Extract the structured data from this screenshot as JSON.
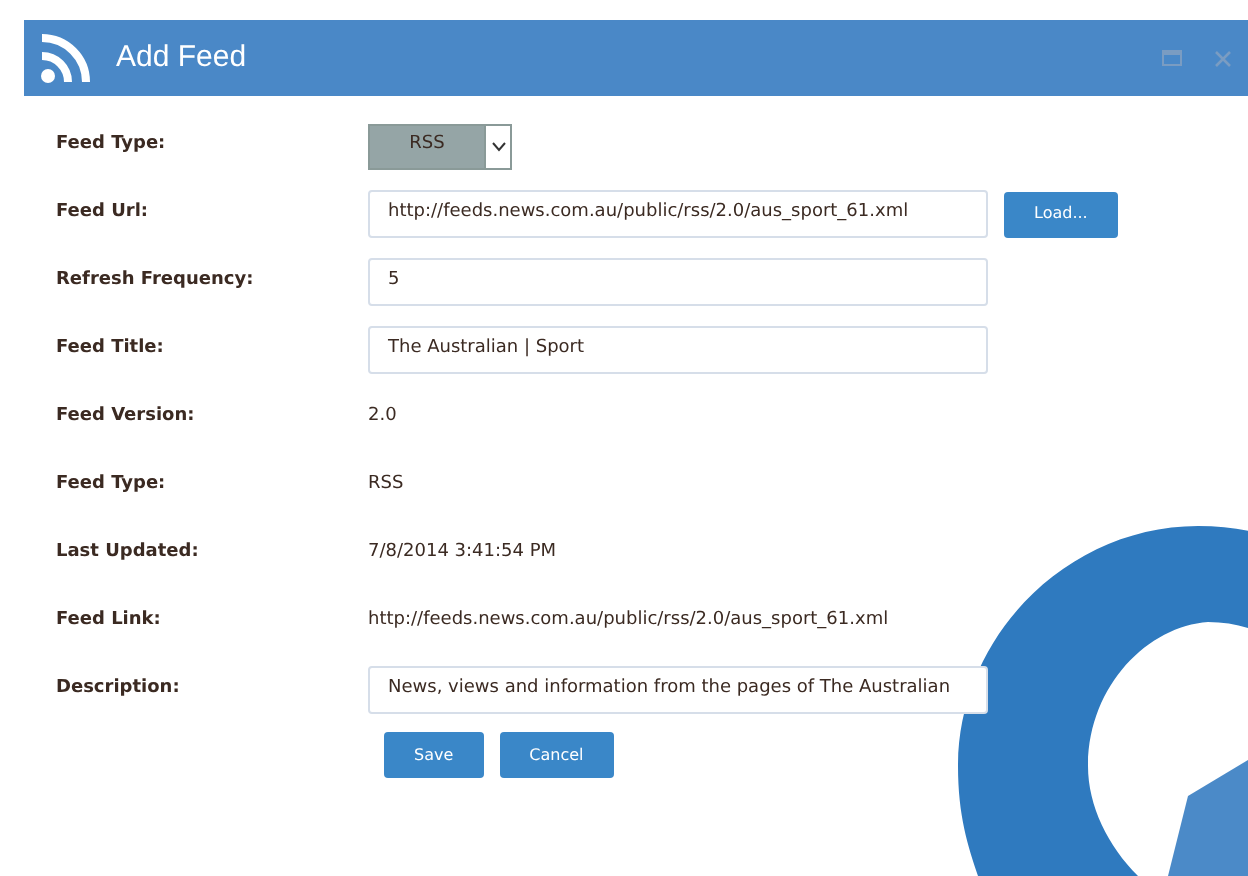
{
  "window": {
    "title": "Add Feed"
  },
  "fields": [
    {
      "kind": "select",
      "label": "Feed Type:",
      "value": "RSS"
    },
    {
      "kind": "input",
      "label": "Feed Url:",
      "value": "http://feeds.news.com.au/public/rss/2.0/aus_sport_61.xml",
      "button": "Load..."
    },
    {
      "kind": "input",
      "label": "Refresh Frequency:",
      "value": "5"
    },
    {
      "kind": "input",
      "label": "Feed Title:",
      "value": "The Australian | Sport"
    },
    {
      "kind": "text",
      "label": "Feed Version:",
      "value": "2.0"
    },
    {
      "kind": "text",
      "label": "Feed Type:",
      "value": "RSS"
    },
    {
      "kind": "text",
      "label": "Last Updated:",
      "value": "7/8/2014 3:41:54 PM"
    },
    {
      "kind": "text",
      "label": "Feed Link:",
      "value": "http://feeds.news.com.au/public/rss/2.0/aus_sport_61.xml"
    },
    {
      "kind": "input",
      "label": "Description:",
      "value": "News, views and information from the pages of The Australian"
    }
  ],
  "buttons": [
    "Save",
    "Cancel"
  ]
}
